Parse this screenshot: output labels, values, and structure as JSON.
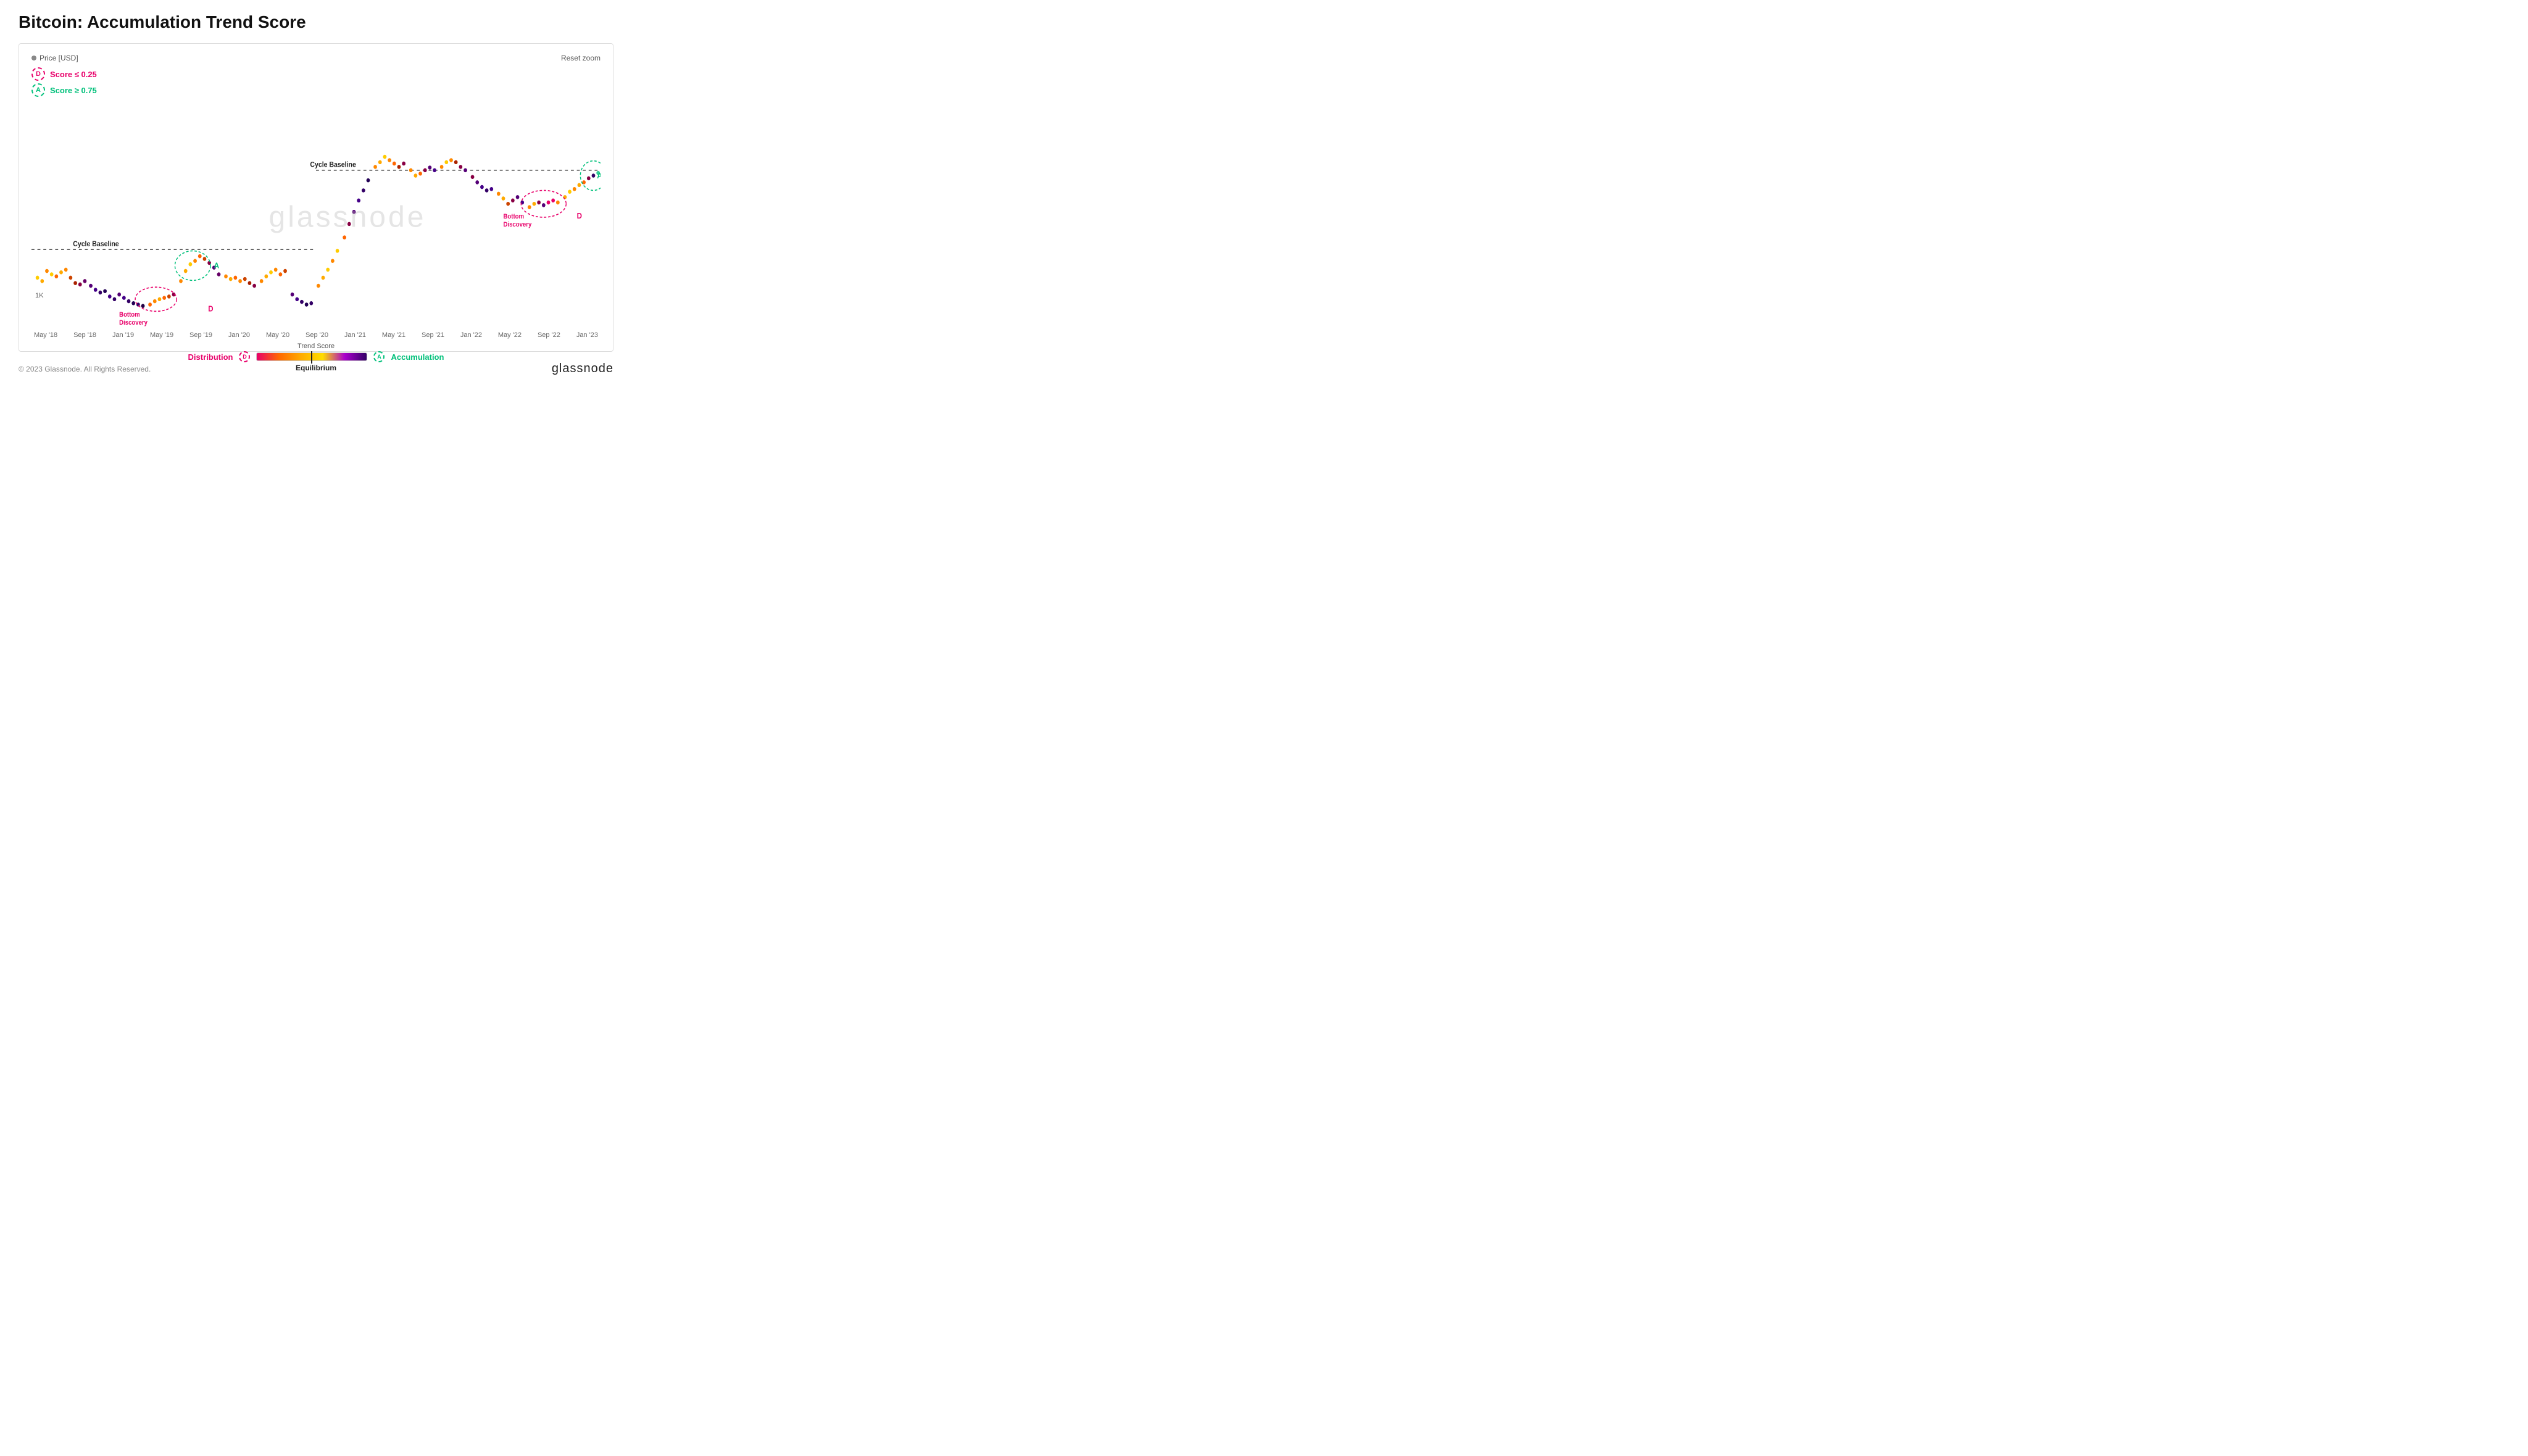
{
  "page": {
    "title": "Bitcoin: Accumulation Trend Score"
  },
  "header": {
    "price_label": "Price [USD]",
    "reset_zoom": "Reset zoom"
  },
  "legend": {
    "d_badge": "D",
    "a_badge": "A",
    "score_d": "Score ≤ 0.25",
    "score_a": "Score ≥ 0.75"
  },
  "chart": {
    "watermark": "glassnode",
    "cycle_baseline_1": "Cycle Baseline",
    "cycle_baseline_2": "Cycle Baseline",
    "bottom_discovery_1": "Bottom\nDiscovery",
    "bottom_discovery_2": "Bottom\nDiscovery",
    "y_label_1k": "1K"
  },
  "trend_score": {
    "label": "Trend Score",
    "distribution": "Distribution",
    "accumulation": "Accumulation",
    "d_badge": "D",
    "a_badge": "A",
    "equilibrium": "Equilibrium"
  },
  "xaxis": {
    "labels": [
      "May '18",
      "Sep '18",
      "Jan '19",
      "May '19",
      "Sep '19",
      "Jan '20",
      "May '20",
      "Sep '20",
      "Jan '21",
      "May '21",
      "Sep '21",
      "Jan '22",
      "May '22",
      "Sep '22",
      "Jan '23"
    ]
  },
  "footer": {
    "copyright": "© 2023 Glassnode. All Rights Reserved.",
    "logo": "glassnode"
  }
}
